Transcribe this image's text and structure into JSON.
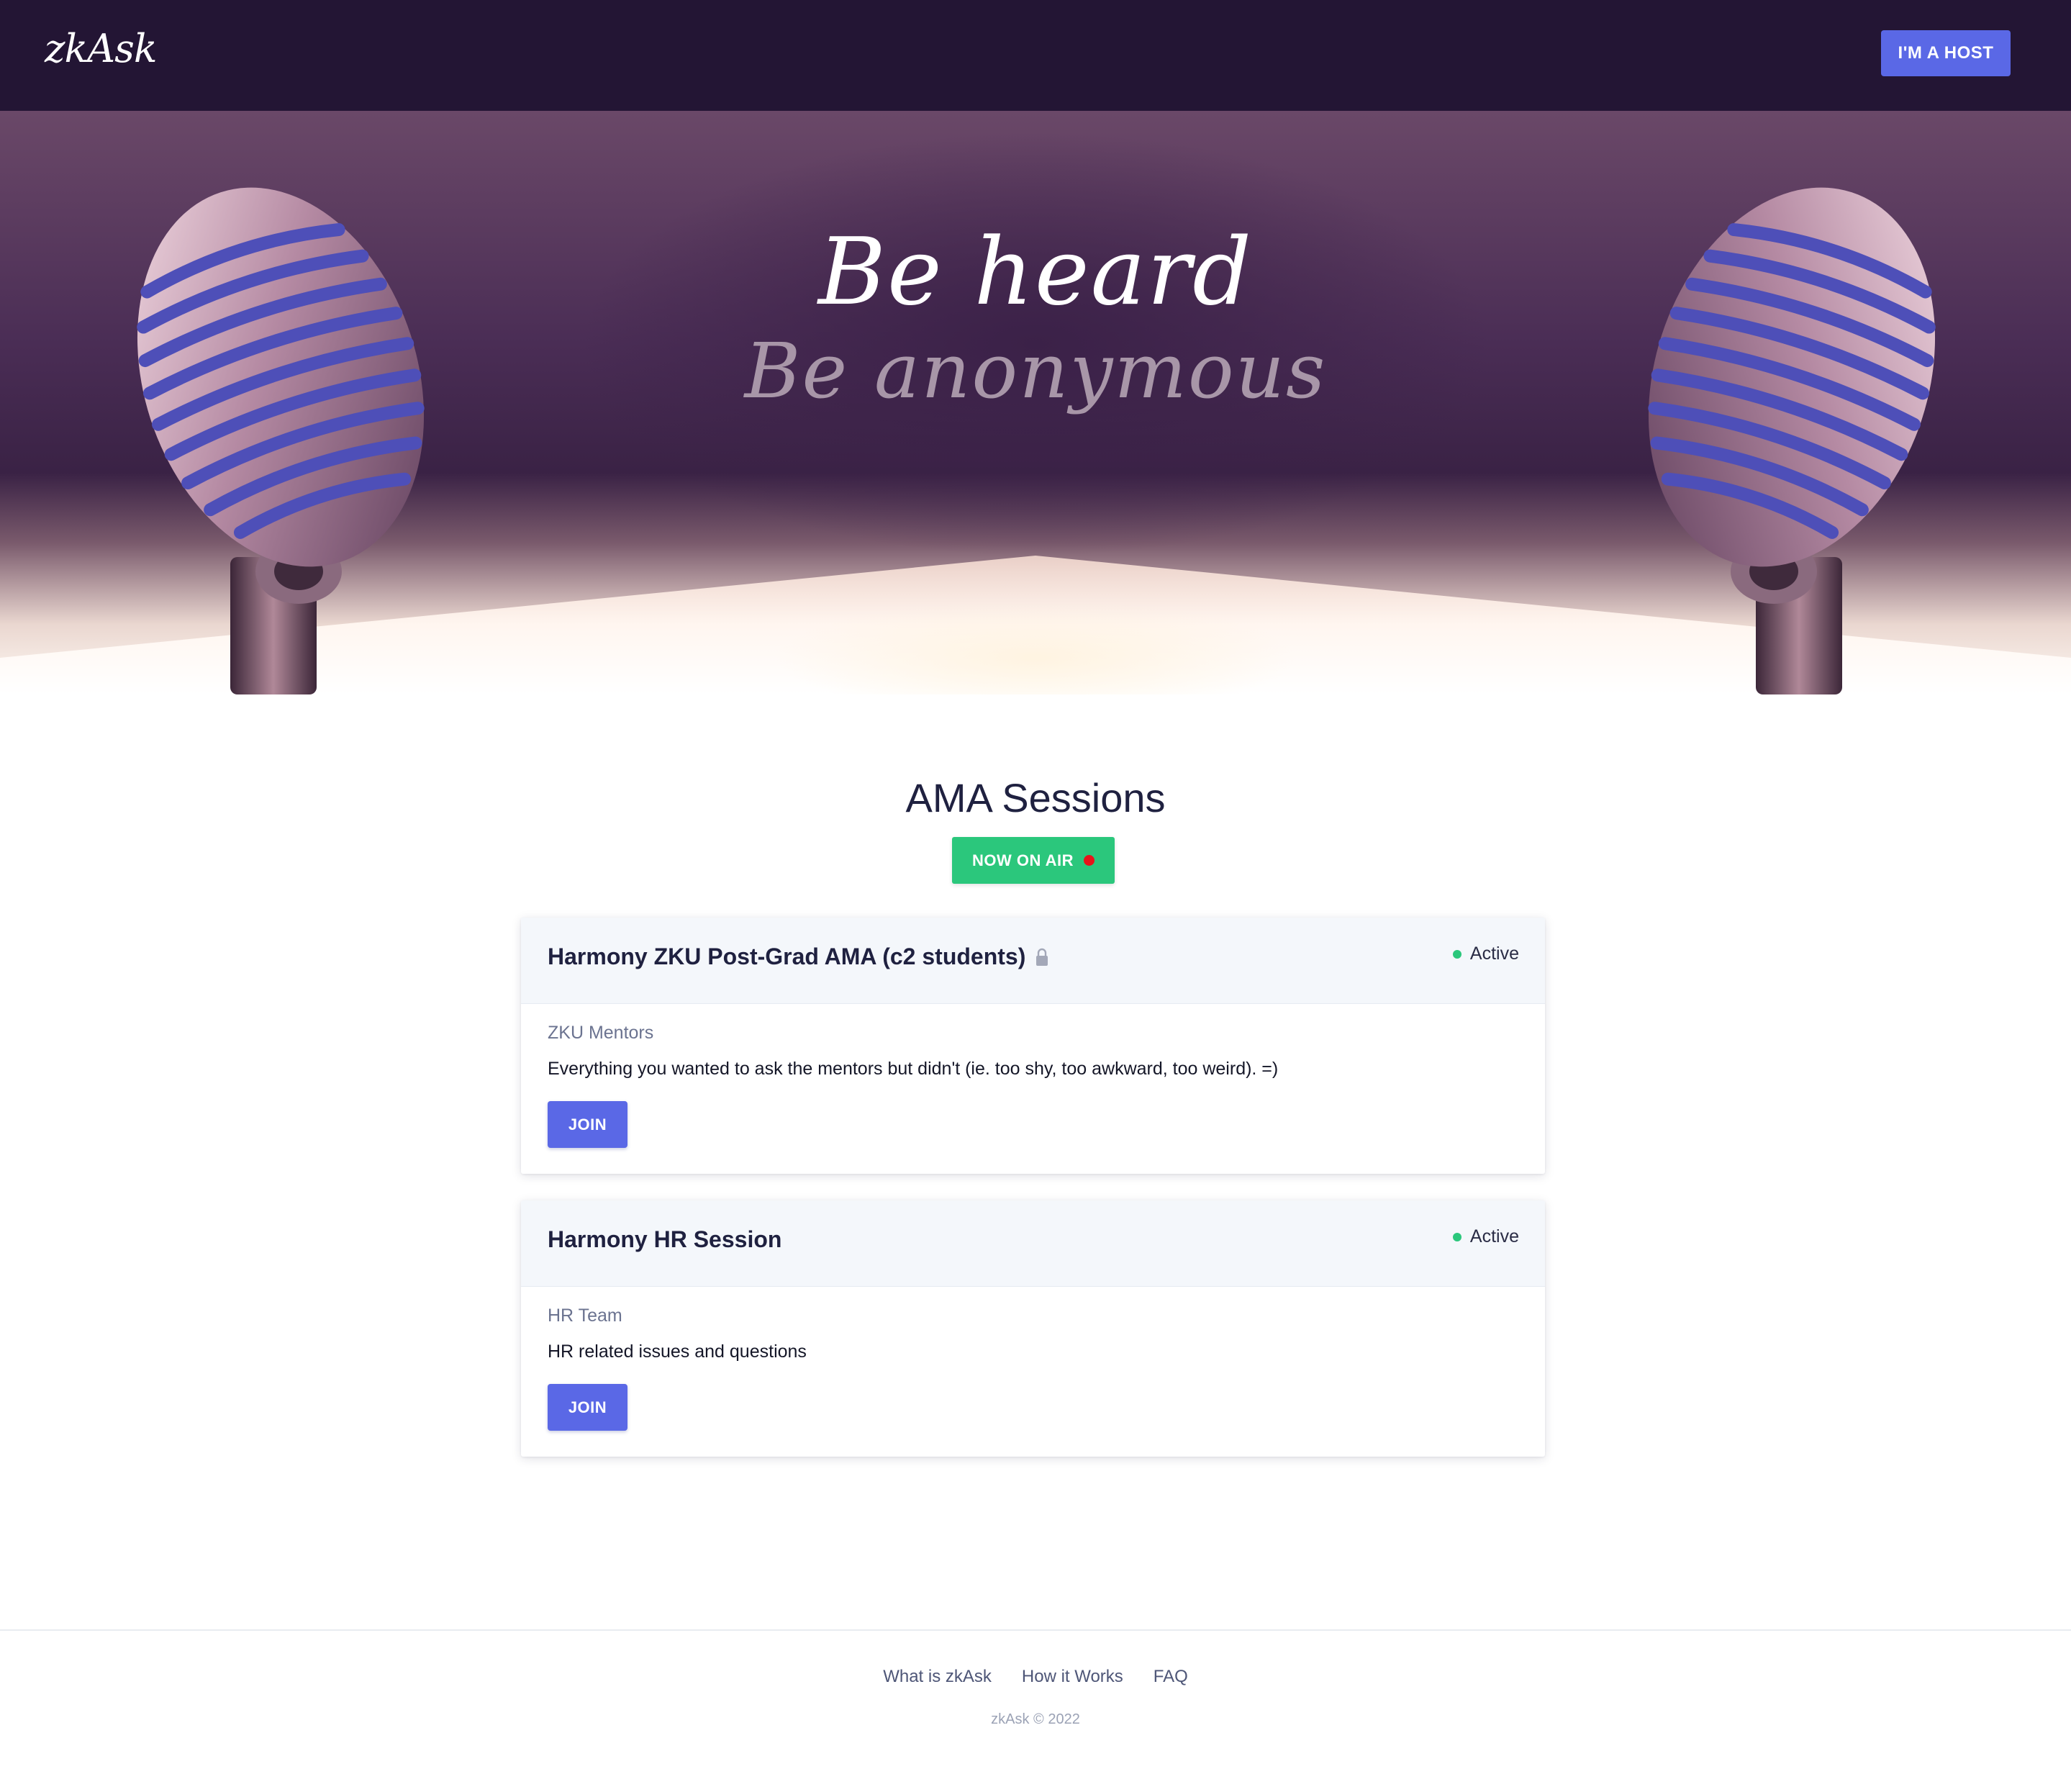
{
  "header": {
    "logo_text": "zkAsk",
    "host_button_label": "I'M A HOST"
  },
  "hero": {
    "title": "Be heard",
    "subtitle": "Be anonymous"
  },
  "sessions": {
    "heading": "AMA Sessions",
    "badge_label": "NOW ON AIR",
    "items": [
      {
        "title": "Harmony ZKU Post-Grad AMA (c2 students)",
        "locked": true,
        "status": "Active",
        "host": "ZKU Mentors",
        "description": "Everything you wanted to ask the mentors but didn't (ie. too shy, too awkward, too weird). =)",
        "button_label": "JOIN"
      },
      {
        "title": "Harmony HR Session",
        "locked": false,
        "status": "Active",
        "host": "HR Team",
        "description": "HR related issues and questions",
        "button_label": "JOIN"
      }
    ]
  },
  "footer": {
    "links": [
      "What is zkAsk",
      "How it Works",
      "FAQ"
    ],
    "copyright": "zkAsk © 2022"
  },
  "colors": {
    "header_bg": "#231534",
    "accent": "#5a68e6",
    "live_green": "#2bc77c",
    "rec_red": "#e8141a"
  },
  "icons": {
    "lock": "lock-icon",
    "status": "status-dot-icon",
    "rec": "rec-dot-icon",
    "microphone": "microphone-icon"
  }
}
